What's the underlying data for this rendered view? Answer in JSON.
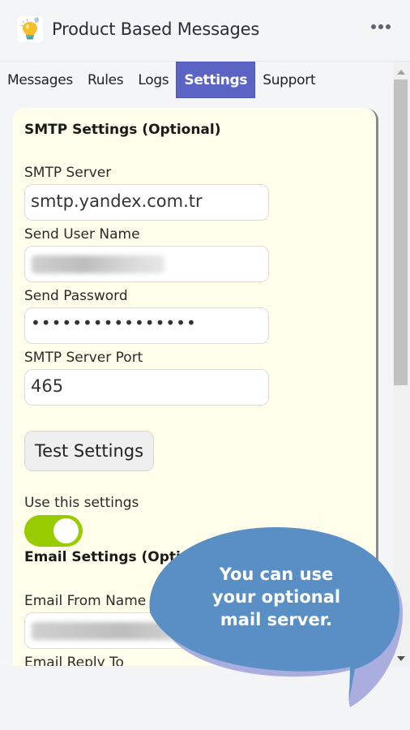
{
  "header": {
    "title": "Product Based Messages",
    "logo_icon": "lightbulb-icon",
    "more_icon": "more-horizontal-icon"
  },
  "tabs": [
    {
      "label": "Messages",
      "active": false
    },
    {
      "label": "Rules",
      "active": false
    },
    {
      "label": "Logs",
      "active": false
    },
    {
      "label": "Settings",
      "active": true
    },
    {
      "label": "Support",
      "active": false
    }
  ],
  "smtp": {
    "section_title": "SMTP Settings (Optional)",
    "server_label": "SMTP Server",
    "server_value": "smtp.yandex.com.tr",
    "username_label": "Send User Name",
    "username_value": "",
    "password_label": "Send Password",
    "password_value": "••••••••••••••••",
    "port_label": "SMTP Server Port",
    "port_value": "465",
    "test_button": "Test Settings",
    "use_label": "Use this settings",
    "use_enabled": true
  },
  "email": {
    "section_title": "Email Settings (Optional)",
    "from_name_label": "Email From Name",
    "from_name_value": "",
    "reply_to_label": "Email Reply To"
  },
  "callout": {
    "text_line1": "You can use",
    "text_line2": "your optional",
    "text_line3": "mail server."
  },
  "colors": {
    "accent": "#5b64c3",
    "toggle_on": "#99cc00",
    "panel_bg": "#fefeeb",
    "callout": "#5a8fc6"
  }
}
